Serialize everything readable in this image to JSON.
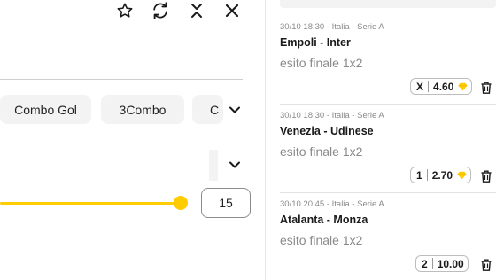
{
  "toolbar": {
    "icons": [
      "star-icon",
      "refresh-icon",
      "collapse-icon",
      "close-icon"
    ]
  },
  "combo_chips": [
    {
      "label": "Combo Gol"
    },
    {
      "label": "3Combo"
    },
    {
      "label": "C"
    }
  ],
  "slider": {
    "value": "15",
    "fill_fraction": 1.0,
    "accent_color": "#ffcc00"
  },
  "bets": [
    {
      "meta": "30/10 18:30 - Italia - Serie A",
      "match": "Empoli - Inter",
      "market": "esito finale 1x2",
      "selection": "X",
      "odds": "4.60",
      "boost": true
    },
    {
      "meta": "30/10 18:30 - Italia - Serie A",
      "match": "Venezia - Udinese",
      "market": "esito finale 1x2",
      "selection": "1",
      "odds": "2.70",
      "boost": true
    },
    {
      "meta": "30/10 20:45 - Italia - Serie A",
      "match": "Atalanta - Monza",
      "market": "esito finale 1x2",
      "selection": "2",
      "odds": "10.00",
      "boost": false
    }
  ]
}
